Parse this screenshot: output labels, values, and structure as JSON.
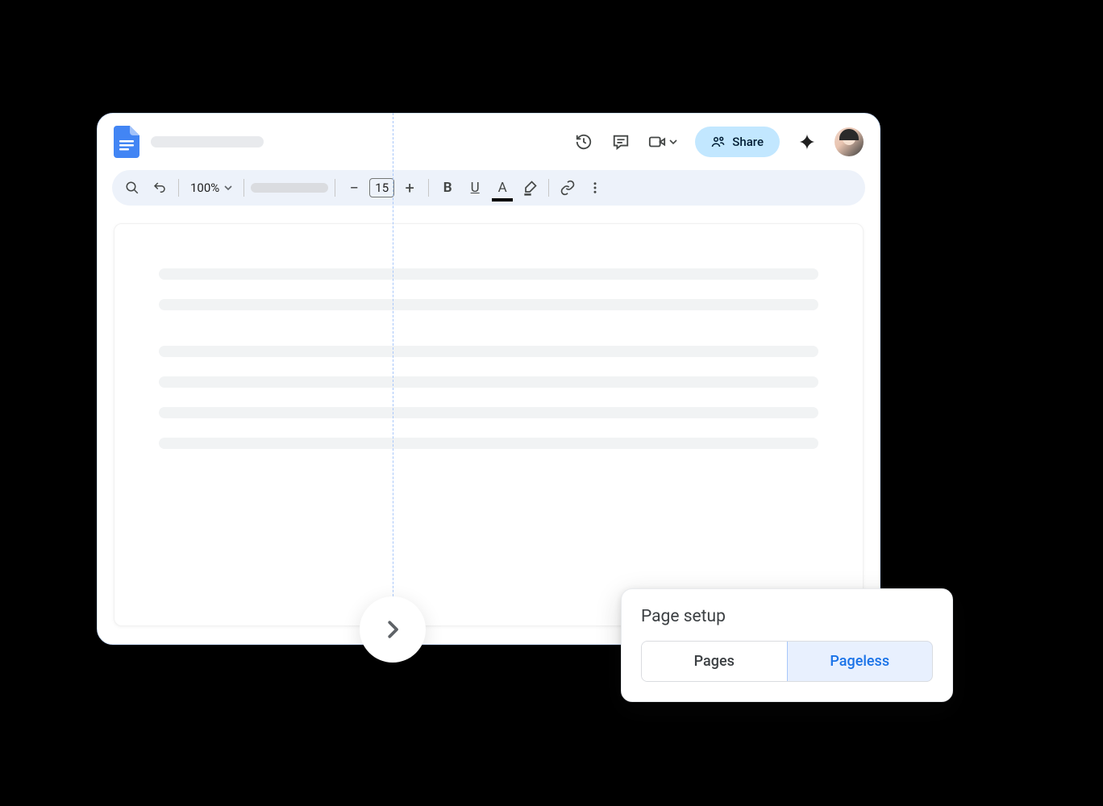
{
  "header": {
    "share_label": "Share"
  },
  "toolbar": {
    "zoom": "100%",
    "font_size": "15"
  },
  "popup": {
    "title": "Page setup",
    "option_pages": "Pages",
    "option_pageless": "Pageless",
    "active": "pageless"
  },
  "colors": {
    "brand_blue": "#4285f4",
    "share_bg": "#c2e7ff",
    "toolbar_bg": "#edf2fa",
    "active_blue": "#1a73e8",
    "active_bg": "#e8f0fe"
  }
}
